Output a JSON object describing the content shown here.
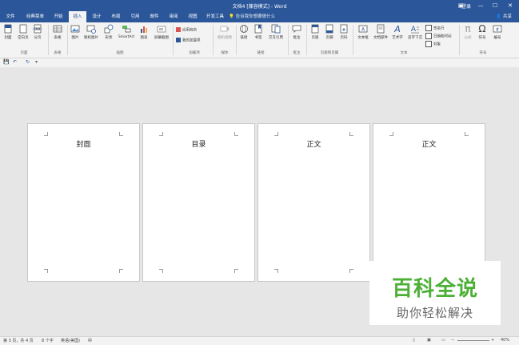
{
  "titlebar": {
    "title": "文档4 [兼容模式] - Word",
    "login": "登录",
    "ribbon_options": "▣",
    "minimize": "—",
    "restore": "☐",
    "close": "✕"
  },
  "tabs": [
    "文件",
    "经典菜单",
    "开始",
    "插入",
    "设计",
    "布局",
    "引用",
    "邮件",
    "审阅",
    "视图",
    "开发工具"
  ],
  "tellme": "告诉我你想要做什么",
  "share": "共享",
  "ribbon": {
    "buttons": {
      "cover": "封面",
      "blank_page": "空白页",
      "page_break": "分页",
      "table": "表格",
      "picture": "图片",
      "online_picture": "联机图片",
      "shapes": "形状",
      "smartart": "SmartArt",
      "chart": "图表",
      "screenshot": "屏幕截图",
      "store": "应用商店",
      "my_addins": "我的加载项",
      "online_video": "联机视频",
      "link": "链接",
      "bookmark": "书签",
      "cross_ref": "交叉引用",
      "comment": "批注",
      "header": "页眉",
      "footer": "页脚",
      "page_number": "页码",
      "textbox": "文本框",
      "doc_parts": "文档部件",
      "wordart": "艺术字",
      "dropcap": "首字下沉",
      "signature": "签名行",
      "datetime": "日期和时间",
      "object": "对象",
      "equation": "公式",
      "symbol": "符号",
      "numbering": "编号"
    },
    "groups": {
      "pages": "页面",
      "tables": "表格",
      "illustrations": "插图",
      "addins": "加载项",
      "media": "媒体",
      "links": "链接",
      "comments": "批注",
      "header_footer": "页眉和页脚",
      "text": "文本",
      "symbols": "符号"
    },
    "icons": {
      "omega": "Ω",
      "pi": "π"
    }
  },
  "qat": {
    "save": "💾",
    "undo": "↶",
    "redo": "↻",
    "more": "▾"
  },
  "pages": [
    "封面",
    "目录",
    "正文",
    "正文"
  ],
  "watermark": {
    "big": "百科全说",
    "small": "助你轻松解决"
  },
  "status": {
    "page_info": "第 3 页，共 4 页",
    "word_count": "8 个字",
    "language": "英语(美国)",
    "zoom": "40%"
  }
}
